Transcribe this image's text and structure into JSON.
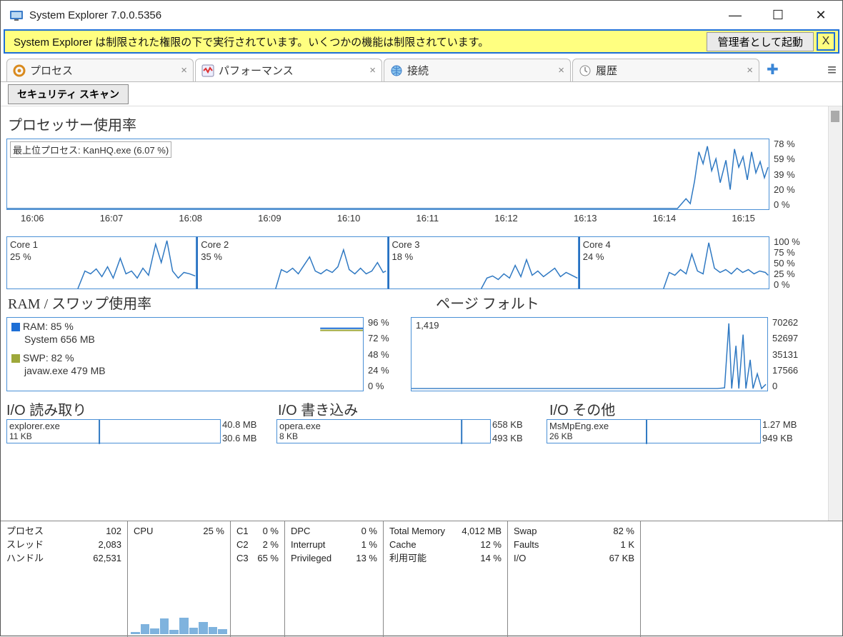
{
  "window": {
    "title": "System Explorer 7.0.0.5356"
  },
  "notice": {
    "message": "System Explorer は制限された権限の下で実行されています。いくつかの機能は制限されています。",
    "admin_button": "管理者として起動",
    "close": "X"
  },
  "tabs": {
    "items": [
      {
        "label": "プロセス"
      },
      {
        "label": "パフォーマンス"
      },
      {
        "label": "接続"
      },
      {
        "label": "履歴"
      }
    ]
  },
  "scanbar": {
    "button": "セキュリティ スキャン"
  },
  "sections": {
    "cpu_title": "プロセッサー使用率",
    "ram_title": "RAM / スワップ使用率",
    "pf_title": "ページ フォルト",
    "io_read": "I/O 読み取り",
    "io_write": "I/O 書き込み",
    "io_other": "I/O その他"
  },
  "cpu_main": {
    "top_process_label": "最上位プロセス: KanHQ.exe (6.07 %)",
    "yticks": [
      "78 %",
      "59 %",
      "39 %",
      "20 %",
      "0 %"
    ],
    "xticks": [
      "16:06",
      "16:07",
      "16:08",
      "16:09",
      "16:10",
      "16:11",
      "16:12",
      "16:13",
      "16:14",
      "16:15"
    ]
  },
  "cores": {
    "yticks": [
      "100 %",
      "75 %",
      "50 %",
      "25 %",
      "0 %"
    ],
    "items": [
      {
        "name": "Core 1",
        "value": "25 %"
      },
      {
        "name": "Core 2",
        "value": "35 %"
      },
      {
        "name": "Core 3",
        "value": "18 %"
      },
      {
        "name": "Core 4",
        "value": "24 %"
      }
    ]
  },
  "ram": {
    "yticks": [
      "96 %",
      "72 %",
      "48 %",
      "24 %",
      "0 %"
    ],
    "ram_label": "RAM: 85 %",
    "ram_sub": "System 656 MB",
    "swp_label": "SWP: 82 %",
    "swp_sub": "javaw.exe 479 MB",
    "color_ram": "#1e6fd6",
    "color_swp": "#9ea83a"
  },
  "pf": {
    "yticks": [
      "70262",
      "52697",
      "35131",
      "17566",
      "0"
    ],
    "value": "1,419"
  },
  "io": {
    "read": {
      "name": "explorer.exe",
      "value": "11 KB",
      "yt": [
        "40.8 MB",
        "30.6 MB"
      ]
    },
    "write": {
      "name": "opera.exe",
      "value": "8 KB",
      "yt": [
        "658 KB",
        "493 KB"
      ]
    },
    "other": {
      "name": "MsMpEng.exe",
      "value": "26 KB",
      "yt": [
        "1.27 MB",
        "949 KB"
      ]
    }
  },
  "status": {
    "c1": [
      [
        "プロセス",
        "102"
      ],
      [
        "スレッド",
        "2,083"
      ],
      [
        "ハンドル",
        "62,531"
      ]
    ],
    "c2": [
      [
        "CPU",
        "25 %"
      ]
    ],
    "c3": [
      [
        "C1",
        "0 %"
      ],
      [
        "C2",
        "2 %"
      ],
      [
        "C3",
        "65 %"
      ]
    ],
    "c4": [
      [
        "DPC",
        "0 %"
      ],
      [
        "Interrupt",
        "1 %"
      ],
      [
        "Privileged",
        "13 %"
      ]
    ],
    "c5": [
      [
        "Total Memory",
        "4,012 MB"
      ],
      [
        "Cache",
        "12 %"
      ],
      [
        "利用可能",
        "14 %"
      ]
    ],
    "c6": [
      [
        "Swap",
        "82 %"
      ],
      [
        "Faults",
        "1 K"
      ],
      [
        "I/O",
        "67 KB"
      ]
    ]
  },
  "chart_data": [
    {
      "type": "line",
      "title": "プロセッサー使用率",
      "x": [
        "16:06",
        "16:07",
        "16:08",
        "16:09",
        "16:10",
        "16:11",
        "16:12",
        "16:13",
        "16:14",
        "16:15"
      ],
      "values": [
        0,
        0,
        0,
        0,
        0,
        0,
        0,
        0,
        5,
        35
      ],
      "ylim": [
        0,
        78
      ],
      "ylabel": "%"
    },
    {
      "type": "line",
      "title": "Core 1",
      "values_recent": [
        28,
        40,
        25,
        32,
        70,
        30,
        25,
        45,
        28,
        35,
        25
      ],
      "ylim": [
        0,
        100
      ]
    },
    {
      "type": "line",
      "title": "Core 2",
      "values_recent": [
        30,
        28,
        35,
        48,
        26,
        32,
        30,
        60,
        28,
        35,
        30
      ],
      "ylim": [
        0,
        100
      ]
    },
    {
      "type": "line",
      "title": "Core 3",
      "values_recent": [
        15,
        28,
        22,
        18,
        42,
        20,
        48,
        25,
        30,
        22,
        18
      ],
      "ylim": [
        0,
        100
      ]
    },
    {
      "type": "line",
      "title": "Core 4",
      "values_recent": [
        20,
        30,
        25,
        50,
        28,
        24,
        80,
        30,
        26,
        32,
        24
      ],
      "ylim": [
        0,
        100
      ]
    },
    {
      "type": "line",
      "title": "RAM / スワップ使用率",
      "series": [
        {
          "name": "RAM",
          "value": 85
        },
        {
          "name": "SWP",
          "value": 82
        }
      ],
      "ylim": [
        0,
        96
      ]
    },
    {
      "type": "line",
      "title": "ページ フォルト",
      "latest": 1419,
      "ylim": [
        0,
        70262
      ]
    },
    {
      "type": "line",
      "title": "I/O 読み取り",
      "latest": "11 KB",
      "ymax": "40.8 MB"
    },
    {
      "type": "line",
      "title": "I/O 書き込み",
      "latest": "8 KB",
      "ymax": "658 KB"
    },
    {
      "type": "line",
      "title": "I/O その他",
      "latest": "26 KB",
      "ymax": "1.27 MB"
    }
  ]
}
